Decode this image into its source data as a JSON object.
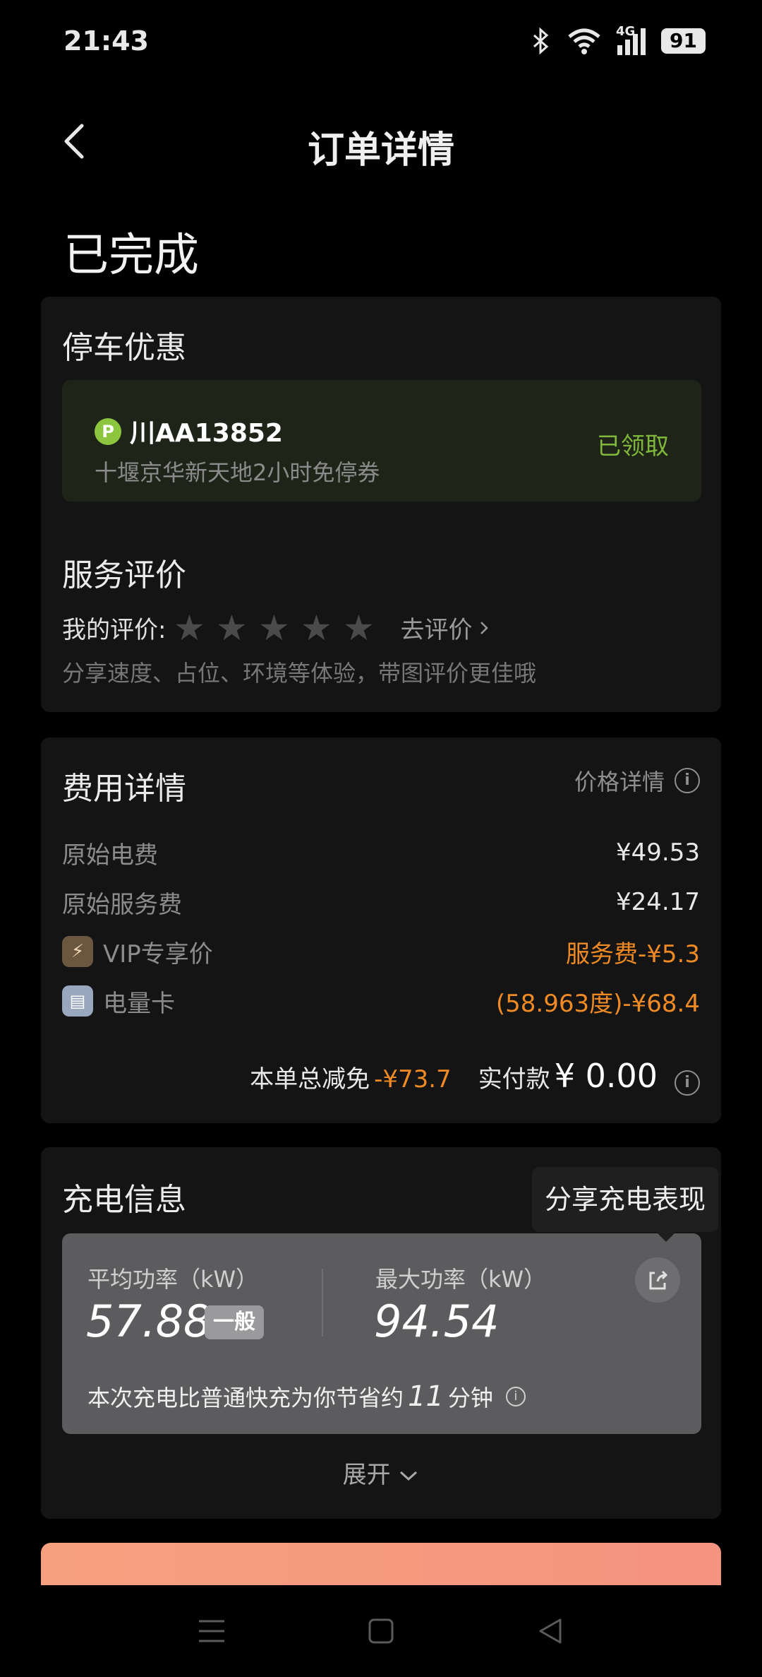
{
  "status_bar": {
    "time": "21:43",
    "signal": "4G",
    "battery": "91",
    "icons": [
      "bluetooth-icon",
      "wifi-icon",
      "signal-icon",
      "battery-icon"
    ]
  },
  "header": {
    "title": "订单详情"
  },
  "order": {
    "status": "已完成"
  },
  "parking": {
    "title": "停车优惠",
    "badge": "P",
    "plate": "川AA13852",
    "description": "十堰京华新天地2小时免停券",
    "state": "已领取"
  },
  "rating": {
    "title": "服务评价",
    "label": "我的评价:",
    "stars": 0,
    "go_rate": "去评价",
    "hint": "分享速度、占位、环境等体验，带图评价更佳哦"
  },
  "fees": {
    "title": "费用详情",
    "price_detail": "价格详情",
    "rows": [
      {
        "label": "原始电费",
        "value": "¥49.53"
      },
      {
        "label": "原始服务费",
        "value": "¥24.17"
      },
      {
        "label": "VIP专享价",
        "value": "服务费-¥5.3"
      },
      {
        "label": "电量卡",
        "value": "(58.963度)-¥68.4"
      }
    ],
    "total_label": "本单总减免",
    "total_discount": "-¥73.7",
    "pay_label": "实付款",
    "pay_amount": "¥ 0.00"
  },
  "charging": {
    "title": "充电信息",
    "tooltip": "分享充电表现",
    "avg_label": "平均功率（kW）",
    "avg_value": "57.88",
    "level": "一般",
    "max_label": "最大功率（kW）",
    "max_value": "94.54",
    "save_prefix": "本次充电比普通快充为你节省约",
    "save_minutes": "11",
    "save_suffix": "分钟",
    "expand": "展开"
  },
  "colors": {
    "accent_orange": "#f08a24",
    "accent_green": "#7fb83a",
    "card_bg": "#141414"
  }
}
